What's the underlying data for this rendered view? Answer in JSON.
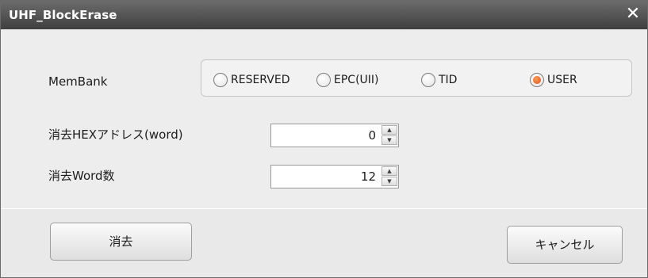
{
  "window": {
    "title": "UHF_BlockErase",
    "close_label": "✕"
  },
  "membank": {
    "label": "MemBank",
    "options": [
      {
        "label": "RESERVED",
        "checked": false
      },
      {
        "label": "EPC(UII)",
        "checked": false
      },
      {
        "label": "TID",
        "checked": false
      },
      {
        "label": "USER",
        "checked": true
      }
    ]
  },
  "address": {
    "label": "消去HEXアドレス(word)",
    "value": "0"
  },
  "word_count": {
    "label": "消去Word数",
    "value": "12"
  },
  "buttons": {
    "erase": "消去",
    "cancel": "キャンセル"
  },
  "colors": {
    "titlebar": "#4f4f4f",
    "radio_selected": "#f07020"
  },
  "icons": {
    "spin_up": "▲",
    "spin_down": "▼"
  }
}
